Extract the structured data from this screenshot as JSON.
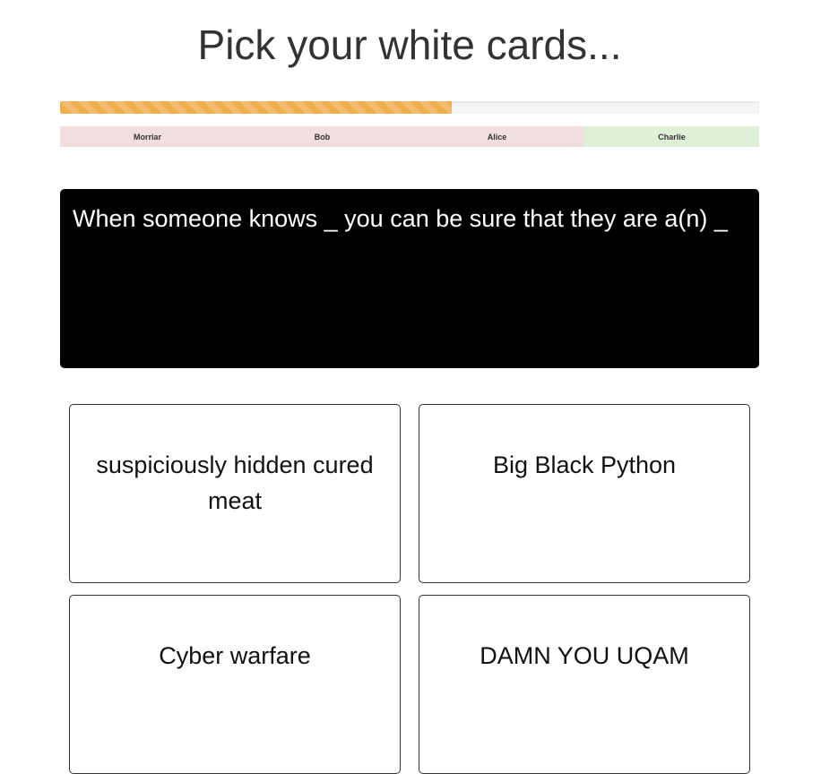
{
  "page": {
    "title": "Pick your white cards..."
  },
  "progress": {
    "percent": 56,
    "color": "#f0ad4e"
  },
  "players": [
    {
      "name": "Morriar",
      "status": "pending",
      "color": "#f2dede"
    },
    {
      "name": "Bob",
      "status": "pending",
      "color": "#f2dede"
    },
    {
      "name": "Alice",
      "status": "pending",
      "color": "#f2dede"
    },
    {
      "name": "Charlie",
      "status": "done",
      "color": "#dff0d8"
    }
  ],
  "black_card": {
    "text": "When someone knows _ you can be sure that they are a(n) _"
  },
  "white_cards": [
    {
      "text": "suspiciously hidden cured meat"
    },
    {
      "text": "Big Black Python"
    },
    {
      "text": "Cyber warfare"
    },
    {
      "text": "DAMN YOU UQAM"
    }
  ]
}
